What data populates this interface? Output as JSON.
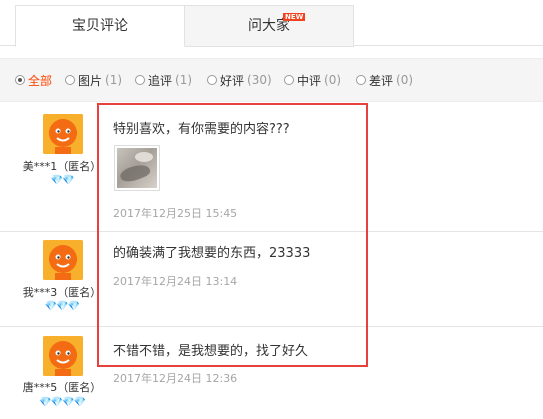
{
  "tabs": [
    {
      "label": "宝贝评论",
      "active": true
    },
    {
      "label": "问大家",
      "active": false,
      "badge": "NEW"
    }
  ],
  "filters": [
    {
      "label": "全部",
      "count": "",
      "checked": true
    },
    {
      "label": "图片",
      "count": "(1)",
      "checked": false
    },
    {
      "label": "追评",
      "count": "(1)",
      "checked": false
    },
    {
      "label": "好评",
      "count": "(30)",
      "checked": false
    },
    {
      "label": "中评",
      "count": "(0)",
      "checked": false
    },
    {
      "label": "差评",
      "count": "(0)",
      "checked": false
    }
  ],
  "reviews": [
    {
      "user": "美***1（匿名）",
      "hearts": "💎💎",
      "text": "特别喜欢，有你需要的内容???",
      "date": "2017年12月25日 15:45",
      "has_image": true
    },
    {
      "user": "我***3（匿名）",
      "hearts": "💎💎💎",
      "text": "的确装满了我想要的东西，23333",
      "date": "2017年12月24日 13:14",
      "has_image": false
    },
    {
      "user": "唐***5（匿名）",
      "hearts": "💎💎💎💎",
      "text": "不错不错，是我想要的，找了好久",
      "date": "2017年12月24日 12:36",
      "has_image": false
    }
  ],
  "colors": {
    "accent": "#ff4400",
    "highlight": "#e8403c",
    "avatar": "#f7a21b"
  }
}
